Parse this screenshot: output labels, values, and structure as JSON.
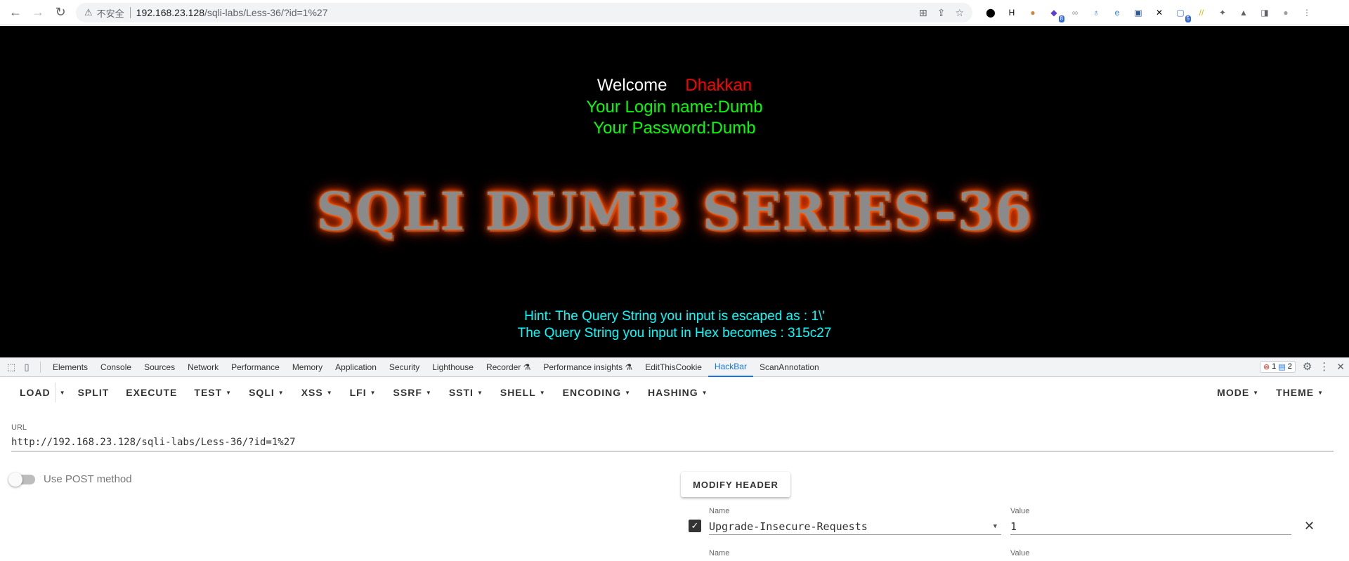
{
  "browser": {
    "insecure_label": "不安全",
    "url_host": "192.168.23.128",
    "url_path": "/sqli-labs/Less-36/?id=1%27",
    "extensions": [
      {
        "icon": "circle-icon",
        "glyph": "⬤",
        "color": "#000000"
      },
      {
        "icon": "h-icon",
        "glyph": "H",
        "color": "#000000"
      },
      {
        "icon": "cookie-icon",
        "glyph": "●",
        "color": "#c98a3c"
      },
      {
        "icon": "stack-icon",
        "glyph": "◆",
        "color": "#5b3fd1",
        "badge": "8"
      },
      {
        "icon": "link-icon",
        "glyph": "∞",
        "color": "#9aa0a6"
      },
      {
        "icon": "pin-icon",
        "glyph": "♁",
        "color": "#1a73e8"
      },
      {
        "icon": "e-icon",
        "glyph": "e",
        "color": "#1a73e8"
      },
      {
        "icon": "w-icon",
        "glyph": "▣",
        "color": "#2b579a"
      },
      {
        "icon": "x-icon",
        "glyph": "✕",
        "color": "#000000"
      },
      {
        "icon": "scan-icon",
        "glyph": "▢",
        "color": "#3367d6",
        "badge": "5"
      },
      {
        "icon": "slash-icon",
        "glyph": "//",
        "color": "#e8b400"
      },
      {
        "icon": "puzzle-icon",
        "glyph": "✦",
        "color": "#5f6368"
      },
      {
        "icon": "flask-icon",
        "glyph": "▲",
        "color": "#5f6368"
      },
      {
        "icon": "sidebar-icon",
        "glyph": "◨",
        "color": "#5f6368"
      },
      {
        "icon": "profile-icon",
        "glyph": "●",
        "color": "#9aa0a6"
      },
      {
        "icon": "kebab-menu-icon",
        "glyph": "⋮",
        "color": "#5f6368"
      }
    ]
  },
  "page": {
    "welcome": "Welcome",
    "user": "Dhakkan",
    "login_name": "Your Login name:Dumb",
    "password": "Your Password:Dumb",
    "series_title": "SQLI DUMB SERIES-36",
    "hint": "Hint: The Query String you input is escaped as : 1\\'",
    "hex": "The Query String you input in Hex becomes : 315c27"
  },
  "devtools": {
    "tabs": [
      "Elements",
      "Console",
      "Sources",
      "Network",
      "Performance",
      "Memory",
      "Application",
      "Security",
      "Lighthouse",
      "Recorder ⚗",
      "Performance insights ⚗",
      "EditThisCookie",
      "HackBar",
      "ScanAnnotation"
    ],
    "active_tab": "HackBar",
    "error_count": "1",
    "message_count": "2"
  },
  "hackbar": {
    "toolbar": {
      "load": "LOAD",
      "split": "SPLIT",
      "execute": "EXECUTE",
      "menus": [
        "TEST",
        "SQLI",
        "XSS",
        "LFI",
        "SSRF",
        "SSTI",
        "SHELL",
        "ENCODING",
        "HASHING"
      ],
      "right_menus": [
        "MODE",
        "THEME"
      ]
    },
    "url_label": "URL",
    "url_value": "http://192.168.23.128/sqli-labs/Less-36/?id=1%27",
    "post_label": "Use POST method",
    "modify_header": "MODIFY HEADER",
    "headers": [
      {
        "name_label": "Name",
        "value_label": "Value",
        "name": "Upgrade-Insecure-Requests",
        "value": "1",
        "checked": true
      },
      {
        "name_label": "Name",
        "value_label": "Value",
        "name": "",
        "value": "",
        "checked": false
      }
    ]
  }
}
